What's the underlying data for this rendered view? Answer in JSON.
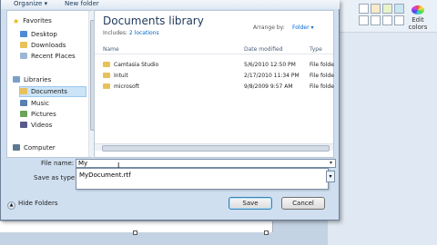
{
  "commandbar": {
    "organize": "Organize ▾",
    "new_folder": "New folder"
  },
  "nav": {
    "favorites": "Favorites",
    "desktop": "Desktop",
    "downloads": "Downloads",
    "recent_places": "Recent Places",
    "libraries": "Libraries",
    "documents": "Documents",
    "music": "Music",
    "pictures": "Pictures",
    "videos": "Videos",
    "computer": "Computer"
  },
  "library": {
    "title": "Documents library",
    "includes_label": "Includes:",
    "includes_link": "2 locations",
    "arrange_label": "Arrange by:",
    "arrange_value": "Folder ▾"
  },
  "columns": {
    "name": "Name",
    "date": "Date modified",
    "type": "Type"
  },
  "files": [
    {
      "name": "Camtasia Studio",
      "date": "5/6/2010 12:50 PM",
      "type": "File folde"
    },
    {
      "name": "Intuit",
      "date": "2/17/2010 11:34 PM",
      "type": "File folde"
    },
    {
      "name": "microsoft",
      "date": "9/8/2009 9:57 AM",
      "type": "File folde"
    }
  ],
  "form": {
    "file_name_label": "File name:",
    "file_name_value": "My",
    "save_as_label": "Save as type:",
    "suggestion": "MyDocument.rtf"
  },
  "footer": {
    "hide_folders": "Hide Folders",
    "save": "Save",
    "cancel": "Cancel"
  },
  "paint": {
    "edit_colors": "Edit colors"
  },
  "colors": {
    "accent": "#1e395b",
    "link": "#0066cc",
    "selection": "#cce4f7"
  }
}
